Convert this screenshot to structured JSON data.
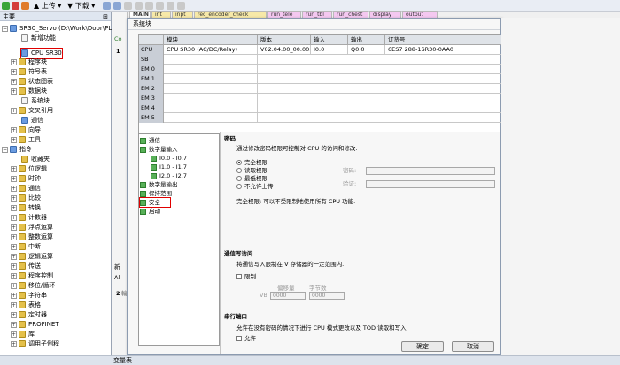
{
  "toolbar": {
    "upload_label": "上传",
    "download_label": "下载"
  },
  "project_tabs": [
    "MAIN",
    "int",
    "inpt",
    "rec_encoder_check",
    "run_tele",
    "run_tbl",
    "run_chest",
    "display",
    "output"
  ],
  "left_tree": {
    "header": "主要",
    "project_title": "SR30_Servo (D:\\Work\\Door\\PL",
    "items": [
      {
        "label": "新增功能"
      },
      {
        "label": "CPU SR30"
      },
      {
        "label": "程序块"
      },
      {
        "label": "符号表"
      },
      {
        "label": "状态图表"
      },
      {
        "label": "数据块"
      },
      {
        "label": "系统块"
      },
      {
        "label": "交叉引用"
      },
      {
        "label": "通信"
      },
      {
        "label": "向导"
      },
      {
        "label": "工具"
      },
      {
        "label": "指令"
      },
      {
        "label": "收藏夹"
      },
      {
        "label": "位逻辑"
      },
      {
        "label": "时钟"
      },
      {
        "label": "通信"
      },
      {
        "label": "比较"
      },
      {
        "label": "转换"
      },
      {
        "label": "计数器"
      },
      {
        "label": "浮点运算"
      },
      {
        "label": "整数运算"
      },
      {
        "label": "中断"
      },
      {
        "label": "逻辑运算"
      },
      {
        "label": "传送"
      },
      {
        "label": "程序控制"
      },
      {
        "label": "移位/循环"
      },
      {
        "label": "字符串"
      },
      {
        "label": "表格"
      },
      {
        "label": "定时器"
      },
      {
        "label": "PROFINET"
      },
      {
        "label": "库"
      },
      {
        "label": "调用子例程"
      }
    ]
  },
  "side_fragments": {
    "c1": "Co",
    "n1": "1",
    "n2": "2",
    "f1": "新",
    "f2": "Al",
    "f3": "輸"
  },
  "dialog": {
    "title": "系统块",
    "columns": [
      "模块",
      "版本",
      "输入",
      "输出",
      "订货号"
    ],
    "rows": [
      {
        "key": "CPU",
        "module": "CPU SR30 (AC/DC/Relay)",
        "version": "V02.04.00_00.00...",
        "input": "I0.0",
        "output": "Q0.0",
        "order": "6ES7 288-1SR30-0AA0"
      },
      {
        "key": "SB",
        "module": "",
        "version": "",
        "input": "",
        "output": "",
        "order": ""
      },
      {
        "key": "EM 0",
        "module": "",
        "version": "",
        "input": "",
        "output": "",
        "order": ""
      },
      {
        "key": "EM 1",
        "module": "",
        "version": "",
        "input": "",
        "output": "",
        "order": ""
      },
      {
        "key": "EM 2",
        "module": "",
        "version": "",
        "input": "",
        "output": "",
        "order": ""
      },
      {
        "key": "EM 3",
        "module": "",
        "version": "",
        "input": "",
        "output": "",
        "order": ""
      },
      {
        "key": "EM 4",
        "module": "",
        "version": "",
        "input": "",
        "output": "",
        "order": ""
      },
      {
        "key": "EM 5",
        "module": "",
        "version": "",
        "input": "",
        "output": "",
        "order": ""
      }
    ],
    "nav": [
      {
        "label": "通信"
      },
      {
        "label": "数字量输入"
      },
      {
        "label": "I0.0 - I0.7"
      },
      {
        "label": "I1.0 - I1.7"
      },
      {
        "label": "I2.0 - I2.7"
      },
      {
        "label": "数字量输出"
      },
      {
        "label": "保持范围"
      },
      {
        "label": "安全"
      },
      {
        "label": "启动"
      }
    ],
    "password": {
      "section": "密码",
      "description": "通过修改密码权限可控制对 CPU 的访问和修改.",
      "options": [
        "完全权限",
        "读取权限",
        "最低权限",
        "不允许上传"
      ],
      "password_label": "密码:",
      "verify_label": "验证:",
      "note": "完全权限: 可以不受限制地使用所有 CPU 功能."
    },
    "comm_write": {
      "section": "通信写访问",
      "description": "将通信写入限制在 V 存储器的一定范围内.",
      "restrict_label": "限制",
      "offset_label": "偏移量",
      "bytes_label": "字节数",
      "vb_label": "VB",
      "offset_value": "0000",
      "bytes_value": "0000"
    },
    "serial": {
      "section": "串行端口",
      "description": "允许在没有密码的情况下进行 CPU 模式更改以及 TOD 读取和写入.",
      "allow_label": "允许"
    },
    "ok_label": "确定",
    "cancel_label": "取消"
  },
  "bottom": {
    "label": "变量表"
  },
  "colors": {
    "highlight": "#e00000",
    "check_green": "#58b058"
  }
}
